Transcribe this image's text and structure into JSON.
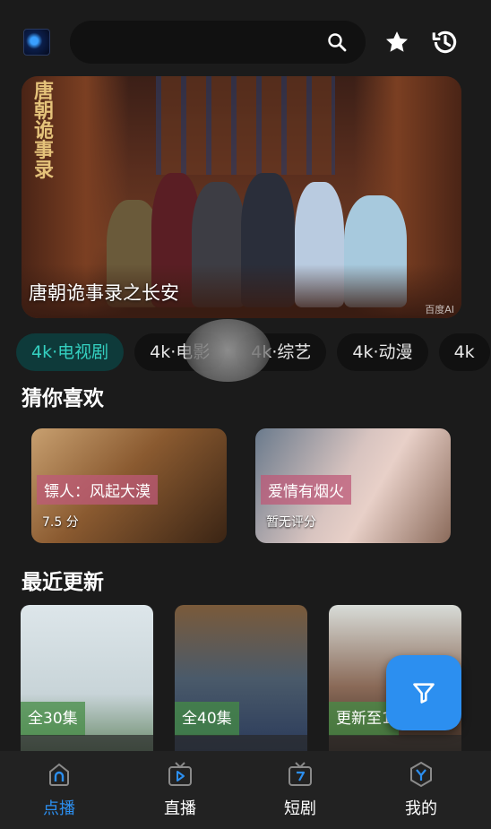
{
  "header": {
    "search_placeholder": "",
    "icons": [
      "app-logo",
      "search-icon",
      "star-icon",
      "history-icon"
    ]
  },
  "banner": {
    "title": "唐朝诡事录之长安",
    "calligraphy": [
      "唐",
      "朝",
      "诡",
      "事",
      "录"
    ],
    "watermark": "百度AI"
  },
  "categories": [
    {
      "label": "4k·电视剧",
      "active": true
    },
    {
      "label": "4k·电影",
      "active": false
    },
    {
      "label": "4k·综艺",
      "active": false
    },
    {
      "label": "4k·动漫",
      "active": false
    },
    {
      "label": "4k",
      "active": false
    }
  ],
  "recommend": {
    "title": "猜你喜欢",
    "items": [
      {
        "name": "镖人：风起大漠",
        "rating": "7.5 分"
      },
      {
        "name": "爱情有烟火",
        "rating": "暂无评分"
      }
    ]
  },
  "recent": {
    "title": "最近更新",
    "items": [
      {
        "badge": "全30集"
      },
      {
        "badge": "全40集"
      },
      {
        "badge": "更新至1"
      }
    ]
  },
  "bottom_nav": [
    {
      "label": "点播",
      "active": true
    },
    {
      "label": "直播",
      "active": false
    },
    {
      "label": "短剧",
      "active": false
    },
    {
      "label": "我的",
      "active": false
    }
  ],
  "colors": {
    "accent": "#2c8ff0",
    "category_active_text": "#34d0c0",
    "background": "#1b1b1b"
  }
}
